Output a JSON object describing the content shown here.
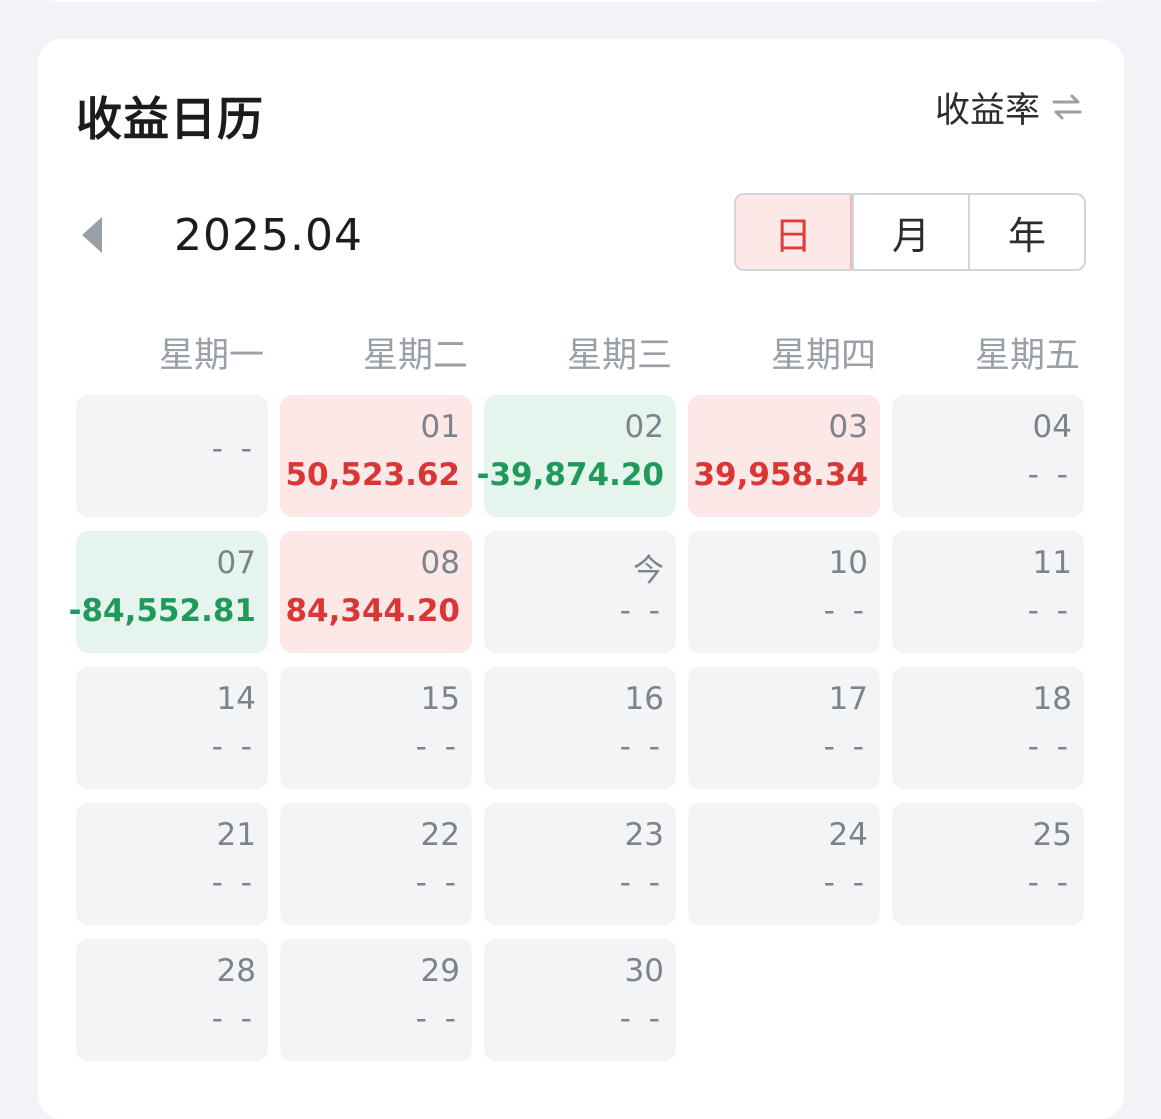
{
  "header": {
    "title": "收益日历",
    "rate_toggle_label": "收益率"
  },
  "nav": {
    "month": "2025.04"
  },
  "segment": {
    "options": [
      "日",
      "月",
      "年"
    ],
    "active_index": 0
  },
  "weekdays": [
    "星期一",
    "星期二",
    "星期三",
    "星期四",
    "星期五"
  ],
  "colors": {
    "gain": "#d93636",
    "loss": "#1f9a5b",
    "gain_bg": "#fde8e8",
    "loss_bg": "#e6f4ee",
    "empty_bg": "#f3f4f6"
  },
  "weeks": [
    [
      {
        "day": "",
        "value": "- -",
        "state": "empty"
      },
      {
        "day": "01",
        "value": "50,523.62",
        "state": "up"
      },
      {
        "day": "02",
        "value": "-39,874.20",
        "state": "down"
      },
      {
        "day": "03",
        "value": "39,958.34",
        "state": "up"
      },
      {
        "day": "04",
        "value": "- -",
        "state": "empty"
      }
    ],
    [
      {
        "day": "07",
        "value": "-84,552.81",
        "state": "down"
      },
      {
        "day": "08",
        "value": "84,344.20",
        "state": "up"
      },
      {
        "day": "今",
        "value": "- -",
        "state": "empty"
      },
      {
        "day": "10",
        "value": "- -",
        "state": "empty"
      },
      {
        "day": "11",
        "value": "- -",
        "state": "empty"
      }
    ],
    [
      {
        "day": "14",
        "value": "- -",
        "state": "empty"
      },
      {
        "day": "15",
        "value": "- -",
        "state": "empty"
      },
      {
        "day": "16",
        "value": "- -",
        "state": "empty"
      },
      {
        "day": "17",
        "value": "- -",
        "state": "empty"
      },
      {
        "day": "18",
        "value": "- -",
        "state": "empty"
      }
    ],
    [
      {
        "day": "21",
        "value": "- -",
        "state": "empty"
      },
      {
        "day": "22",
        "value": "- -",
        "state": "empty"
      },
      {
        "day": "23",
        "value": "- -",
        "state": "empty"
      },
      {
        "day": "24",
        "value": "- -",
        "state": "empty"
      },
      {
        "day": "25",
        "value": "- -",
        "state": "empty"
      }
    ],
    [
      {
        "day": "28",
        "value": "- -",
        "state": "empty"
      },
      {
        "day": "29",
        "value": "- -",
        "state": "empty"
      },
      {
        "day": "30",
        "value": "- -",
        "state": "empty"
      }
    ]
  ]
}
